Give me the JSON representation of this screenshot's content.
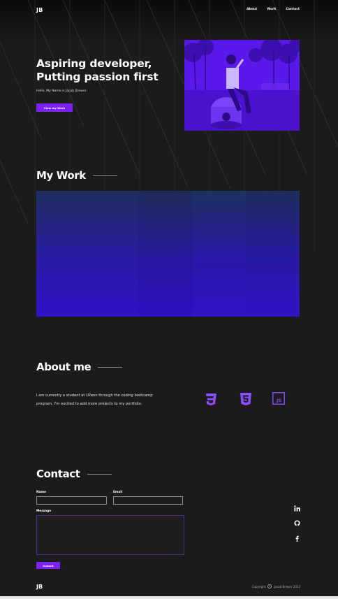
{
  "header": {
    "logo": "JB",
    "nav": [
      "About",
      "Work",
      "Contact"
    ]
  },
  "hero": {
    "title_line1": "Aspiring developer,",
    "title_line2": "Putting passion first",
    "subtitle": "Hello, My Name is Jacob Brewer.",
    "button": "View my Work"
  },
  "work": {
    "title": "My Work"
  },
  "about": {
    "title": "About me",
    "text": "I am currently a student at UPenn through the coding bootcamp program. I'm excited to add more projects to my portfolio.",
    "skills": [
      "css3-icon",
      "html5-icon",
      "javascript-icon"
    ]
  },
  "contact": {
    "title": "Contact",
    "name_label": "Name",
    "email_label": "Email",
    "message_label": "Message",
    "submit": "Submit",
    "socials": [
      "linkedin-icon",
      "github-icon",
      "facebook-icon"
    ]
  },
  "footer": {
    "logo": "JB",
    "copyright_prefix": "Copyright",
    "copyright_owner": "Jacob Brewer 2021"
  },
  "colors": {
    "accent": "#7b22f2",
    "background": "#1b1b1b",
    "icon": "#8a4dff"
  }
}
